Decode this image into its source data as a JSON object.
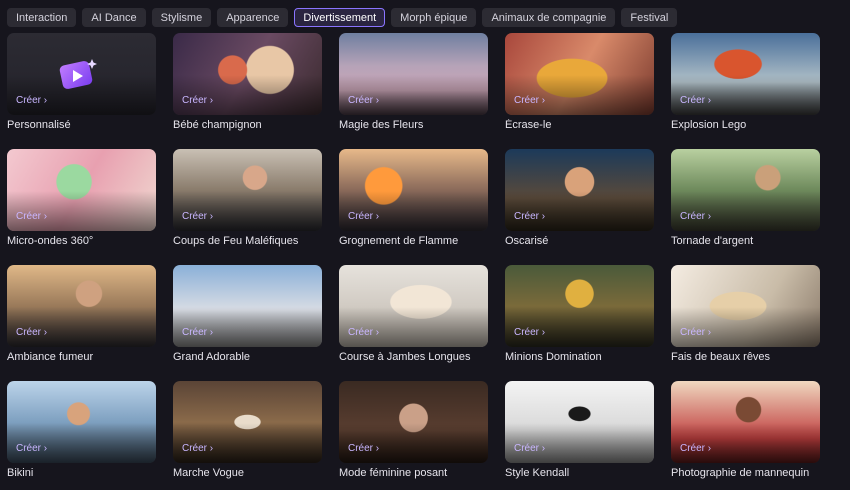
{
  "tabs": [
    {
      "label": "Interaction",
      "active": false
    },
    {
      "label": "AI Dance",
      "active": false
    },
    {
      "label": "Stylisme",
      "active": false
    },
    {
      "label": "Apparence",
      "active": false
    },
    {
      "label": "Divertissement",
      "active": true
    },
    {
      "label": "Morph épique",
      "active": false
    },
    {
      "label": "Animaux de compagnie",
      "active": false
    },
    {
      "label": "Festival",
      "active": false
    }
  ],
  "create_label": "Créer ›",
  "cards": [
    {
      "title": "Personnalisé"
    },
    {
      "title": "Bébé champignon"
    },
    {
      "title": "Magie des Fleurs"
    },
    {
      "title": "Écrase-le"
    },
    {
      "title": "Explosion Lego"
    },
    {
      "title": "Micro-ondes 360°"
    },
    {
      "title": "Coups de Feu Maléfiques"
    },
    {
      "title": "Grognement de Flamme"
    },
    {
      "title": "Oscarisé"
    },
    {
      "title": "Tornade d'argent"
    },
    {
      "title": "Ambiance fumeur"
    },
    {
      "title": "Grand Adorable"
    },
    {
      "title": "Course à Jambes Longues"
    },
    {
      "title": "Minions Domination"
    },
    {
      "title": "Fais de beaux rêves"
    },
    {
      "title": "Bikini"
    },
    {
      "title": "Marche Vogue"
    },
    {
      "title": "Mode féminine posant"
    },
    {
      "title": "Style Kendall"
    },
    {
      "title": "Photographie de mannequin"
    }
  ]
}
